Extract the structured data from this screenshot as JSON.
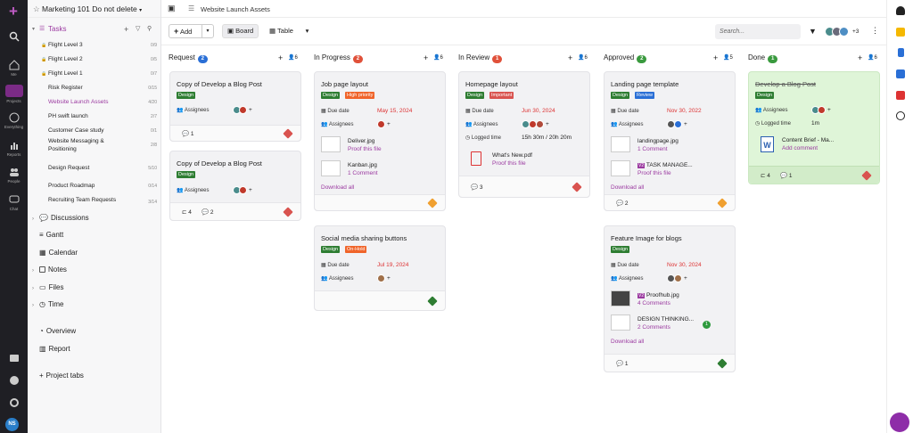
{
  "rail": {
    "items": [
      {
        "label": "Me"
      },
      {
        "label": "Projects"
      },
      {
        "label": "Everything"
      },
      {
        "label": "Reports"
      },
      {
        "label": "People"
      },
      {
        "label": "Chat"
      }
    ],
    "avatar": "NS"
  },
  "project": {
    "name": "Marketing 101 Do not delete"
  },
  "tasks_header": "Tasks",
  "task_lists": [
    {
      "label": "Flight Level 3",
      "count": "0/9"
    },
    {
      "label": "Flight Level 2",
      "count": "0/5"
    },
    {
      "label": "Flight Level 1",
      "count": "0/7"
    },
    {
      "label": "Risk Register",
      "count": "0/15"
    },
    {
      "label": "Website Launch Assets",
      "count": "4/20"
    },
    {
      "label": "PH swift launch",
      "count": "2/7"
    },
    {
      "label": "Customer Case study",
      "count": "0/1"
    },
    {
      "label": "Website Messaging & Positioning",
      "count": "2/8"
    },
    {
      "label": "Design Request",
      "count": "5/10"
    },
    {
      "label": "Product Roadmap",
      "count": "0/14"
    },
    {
      "label": "Recruiting Team Requests",
      "count": "3/14"
    }
  ],
  "sections": {
    "discussions": "Discussions",
    "gantt": "Gantt",
    "calendar": "Calendar",
    "notes": "Notes",
    "files": "Files",
    "time": "Time",
    "overview": "Overview",
    "report": "Report",
    "project_tabs": "Project tabs"
  },
  "breadcrumb": "Website Launch Assets",
  "toolbar": {
    "add": "Add",
    "board": "Board",
    "table": "Table",
    "search_placeholder": "Search...",
    "more_avatars": "+3"
  },
  "columns": [
    {
      "name": "Request",
      "count": "2",
      "color": "#2a6fd6",
      "people": "6"
    },
    {
      "name": "In Progress",
      "count": "2",
      "color": "#e0513a",
      "people": "6"
    },
    {
      "name": "In Review",
      "count": "1",
      "color": "#e0513a",
      "people": "6"
    },
    {
      "name": "Approved",
      "count": "2",
      "color": "#3a9a3e",
      "people": "5"
    },
    {
      "name": "Done",
      "count": "1",
      "color": "#3a9a3e",
      "people": "6"
    }
  ],
  "labels": {
    "assignees": "Assignees",
    "due_date": "Due date",
    "logged_time": "Logged time",
    "download_all": "Download all",
    "proof_this_file": "Proof this file",
    "add_comment": "Add comment"
  },
  "cards": {
    "r1": {
      "title": "Copy of Develop a Blog Post",
      "tag": "Design",
      "comments": "1"
    },
    "r2": {
      "title": "Copy of Develop a Blog Post",
      "tag": "Design",
      "subtasks": "4",
      "comments": "2"
    },
    "p1": {
      "title": "Job page layout",
      "tags": [
        "Design",
        "High priority"
      ],
      "due": "May 15, 2024",
      "files": [
        {
          "name": "Deliver.jpg",
          "sub": "Proof this file"
        },
        {
          "name": "Kanban.jpg",
          "sub": "1 Comment"
        }
      ]
    },
    "p2": {
      "title": "Social media sharing buttons",
      "tags": [
        "Design",
        "On-Hold"
      ],
      "due": "Jul 19, 2024"
    },
    "v1": {
      "title": "Homepage layout",
      "tags": [
        "Design",
        "Important"
      ],
      "due": "Jun 30, 2024",
      "logged": "15h 30m / 20h 20m",
      "file": "What's New.pdf",
      "comments": "3"
    },
    "a1": {
      "title": "Landing page template",
      "tags": [
        "Design",
        "Review"
      ],
      "due": "Nov 30, 2022",
      "files": [
        {
          "name": "landingpage.jpg",
          "sub": "1 Comment",
          "ver": ""
        },
        {
          "name": "TASK MANAGE...",
          "sub": "Proof this file",
          "ver": "V2"
        }
      ],
      "comments": "2"
    },
    "a2": {
      "title": "Feature Image for blogs",
      "tag": "Design",
      "due": "Nov 30, 2024",
      "files": [
        {
          "name": "Proofhub.jpg",
          "sub": "4 Comments",
          "ver": "V2"
        },
        {
          "name": "DESIGN THINKING...",
          "sub": "2 Comments",
          "ver": "1"
        }
      ],
      "comments": "1"
    },
    "d1": {
      "title": "Develop a Blog Post",
      "tag": "Design",
      "logged": "1m",
      "file": "Content Brief - Ma...",
      "subtasks": "4",
      "comments": "1"
    }
  },
  "colors": {
    "accent": "#9b3aa0",
    "design_tag": "#2e7d32",
    "done_card": "#dff5d8"
  }
}
